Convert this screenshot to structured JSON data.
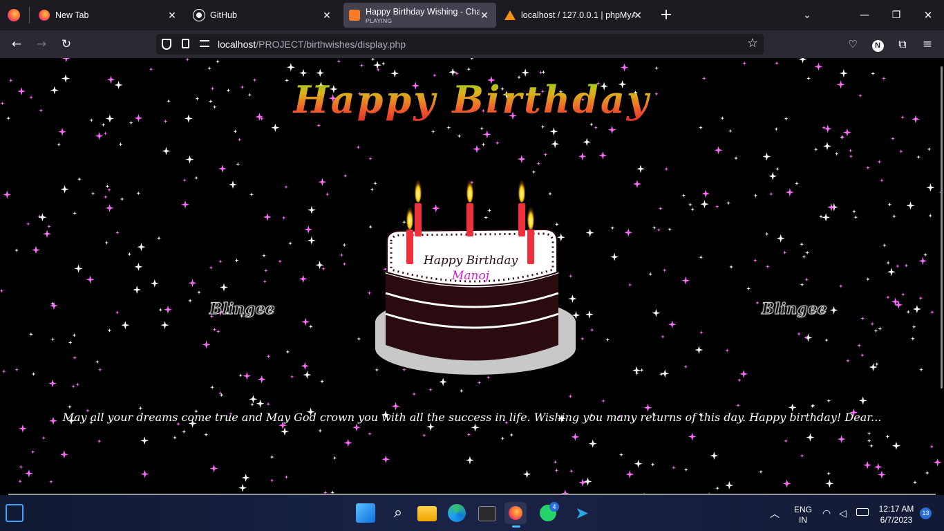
{
  "browser": {
    "tabs": [
      {
        "label": "New Tab"
      },
      {
        "label": "GitHub"
      },
      {
        "label": "Happy Birthday Wishing - Char",
        "status": "PLAYING"
      },
      {
        "label": "localhost / 127.0.0.1 | phpMyAd"
      }
    ],
    "url_host": "localhost",
    "url_path": "/PROJECT/birthwishes/display.php",
    "profile_initial": "N"
  },
  "page": {
    "title": "Happy Birthday",
    "cake_line1": "Happy Birthday",
    "cake_name": "Manoj",
    "watermark_left": "Blingee",
    "watermark_right": "Blingee",
    "wish": "May all your dreams come true and May God crown you with all the success in life. Wishing you many returns of this day. Happy birthday! Dear..."
  },
  "taskbar": {
    "whatsapp_badge": "4",
    "lang_line1": "ENG",
    "lang_line2": "IN",
    "time": "12:17 AM",
    "date": "6/7/2023",
    "notif_count": "13"
  }
}
